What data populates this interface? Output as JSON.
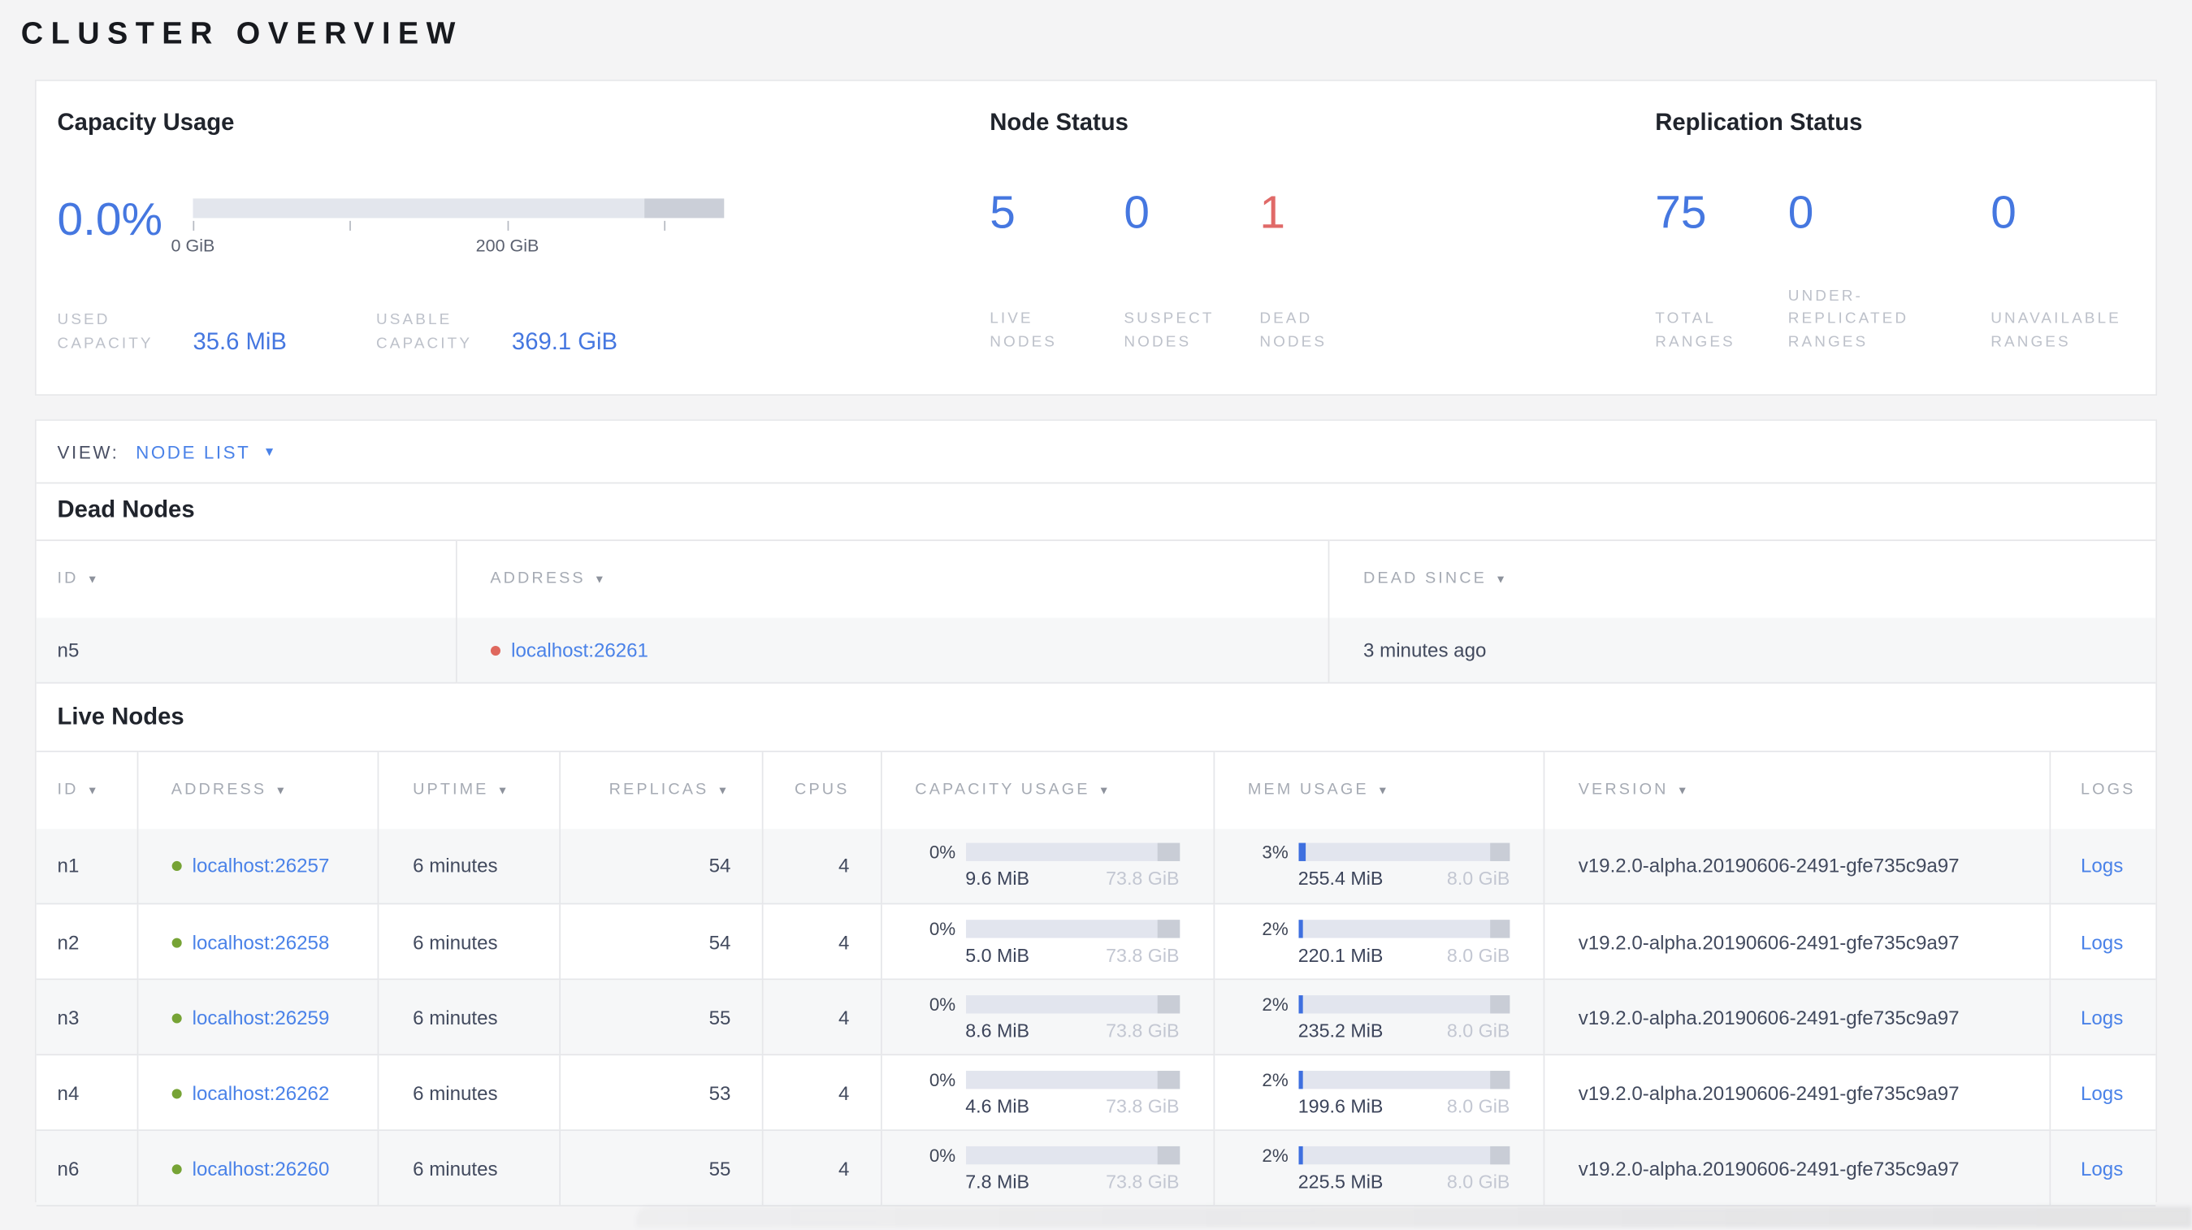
{
  "page": {
    "title": "CLUSTER OVERVIEW"
  },
  "colors": {
    "accent_blue": "#4577e0",
    "link_blue": "#4a82e8",
    "danger_red": "#e06a68",
    "live_green": "#76a335",
    "dead_dot_red": "#df685e"
  },
  "summary": {
    "capacity": {
      "title": "Capacity Usage",
      "percent": "0.0%",
      "tick_labels": [
        "0 GiB",
        "200 GiB"
      ],
      "stats": [
        {
          "label_lines": [
            "USED",
            "CAPACITY"
          ],
          "value": "35.6 MiB"
        },
        {
          "label_lines": [
            "USABLE",
            "CAPACITY"
          ],
          "value": "369.1 GiB"
        }
      ]
    },
    "node_status": {
      "title": "Node Status",
      "stats": [
        {
          "value": "5",
          "label_lines": [
            "LIVE",
            "NODES"
          ]
        },
        {
          "value": "0",
          "label_lines": [
            "SUSPECT",
            "NODES"
          ]
        },
        {
          "value": "1",
          "label_lines": [
            "DEAD",
            "NODES"
          ]
        }
      ]
    },
    "replication_status": {
      "title": "Replication Status",
      "stats": [
        {
          "value": "75",
          "label_lines": [
            "TOTAL",
            "RANGES"
          ]
        },
        {
          "value": "0",
          "label_lines": [
            "UNDER-",
            "REPLICATED",
            "RANGES"
          ]
        },
        {
          "value": "0",
          "label_lines": [
            "UNAVAILABLE",
            "RANGES"
          ]
        }
      ]
    }
  },
  "view_bar": {
    "label": "VIEW:",
    "selected": "NODE LIST",
    "caret_icon": "▼"
  },
  "dead_nodes": {
    "title": "Dead Nodes",
    "columns": [
      {
        "label": "ID",
        "arrow": "▼"
      },
      {
        "label": "ADDRESS",
        "arrow": "▼"
      },
      {
        "label": "DEAD SINCE",
        "arrow": "▼"
      }
    ],
    "rows": [
      {
        "id": "n5",
        "address": "localhost:26261",
        "dead_since": "3 minutes ago"
      }
    ]
  },
  "live_nodes": {
    "title": "Live Nodes",
    "columns": [
      {
        "label": "ID",
        "arrow": "▼"
      },
      {
        "label": "ADDRESS",
        "arrow": "▼"
      },
      {
        "label": "UPTIME",
        "arrow": "▼"
      },
      {
        "label": "REPLICAS",
        "arrow": "▼"
      },
      {
        "label": "CPUS",
        "arrow": ""
      },
      {
        "label": "CAPACITY USAGE",
        "arrow": "▼"
      },
      {
        "label": "MEM USAGE",
        "arrow": "▼"
      },
      {
        "label": "VERSION",
        "arrow": "▼"
      },
      {
        "label": "LOGS",
        "arrow": ""
      }
    ],
    "rows": [
      {
        "id": "n1",
        "address": "localhost:26257",
        "uptime": "6 minutes",
        "replicas": "54",
        "cpus": "4",
        "capacity": {
          "percent": "0%",
          "used": "9.6 MiB",
          "total": "73.8 GiB"
        },
        "memory": {
          "percent": "3%",
          "used": "255.4 MiB",
          "total": "8.0 GiB"
        },
        "version": "v19.2.0-alpha.20190606-2491-gfe735c9a97",
        "logs_label": "Logs"
      },
      {
        "id": "n2",
        "address": "localhost:26258",
        "uptime": "6 minutes",
        "replicas": "54",
        "cpus": "4",
        "capacity": {
          "percent": "0%",
          "used": "5.0 MiB",
          "total": "73.8 GiB"
        },
        "memory": {
          "percent": "2%",
          "used": "220.1 MiB",
          "total": "8.0 GiB"
        },
        "version": "v19.2.0-alpha.20190606-2491-gfe735c9a97",
        "logs_label": "Logs"
      },
      {
        "id": "n3",
        "address": "localhost:26259",
        "uptime": "6 minutes",
        "replicas": "55",
        "cpus": "4",
        "capacity": {
          "percent": "0%",
          "used": "8.6 MiB",
          "total": "73.8 GiB"
        },
        "memory": {
          "percent": "2%",
          "used": "235.2 MiB",
          "total": "8.0 GiB"
        },
        "version": "v19.2.0-alpha.20190606-2491-gfe735c9a97",
        "logs_label": "Logs"
      },
      {
        "id": "n4",
        "address": "localhost:26262",
        "uptime": "6 minutes",
        "replicas": "53",
        "cpus": "4",
        "capacity": {
          "percent": "0%",
          "used": "4.6 MiB",
          "total": "73.8 GiB"
        },
        "memory": {
          "percent": "2%",
          "used": "199.6 MiB",
          "total": "8.0 GiB"
        },
        "version": "v19.2.0-alpha.20190606-2491-gfe735c9a97",
        "logs_label": "Logs"
      },
      {
        "id": "n6",
        "address": "localhost:26260",
        "uptime": "6 minutes",
        "replicas": "55",
        "cpus": "4",
        "capacity": {
          "percent": "0%",
          "used": "7.8 MiB",
          "total": "73.8 GiB"
        },
        "memory": {
          "percent": "2%",
          "used": "225.5 MiB",
          "total": "8.0 GiB"
        },
        "version": "v19.2.0-alpha.20190606-2491-gfe735c9a97",
        "logs_label": "Logs"
      }
    ]
  }
}
